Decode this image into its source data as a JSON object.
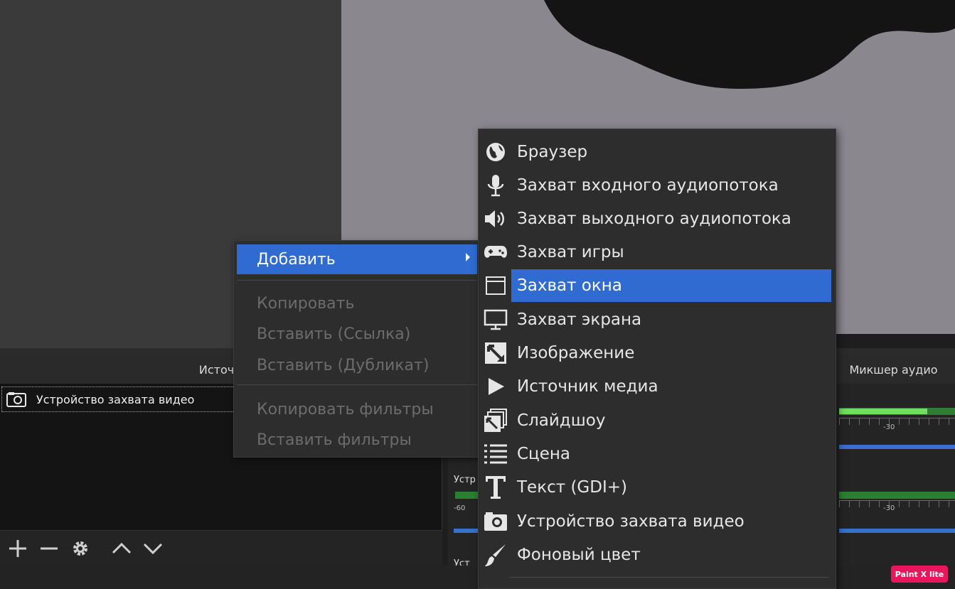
{
  "docks": {
    "sources_title": "Источни",
    "mixer_title": "Микшер аудио"
  },
  "sources": {
    "items": [
      {
        "label": "Устройство захвата видео",
        "icon": "camera-icon"
      }
    ],
    "toolbar": {
      "add": "plus-icon",
      "remove": "minus-icon",
      "settings": "gear-icon",
      "up": "chevron-up-icon",
      "down": "chevron-down-icon"
    }
  },
  "mixer": {
    "channels": [
      {
        "label": "",
        "tick_label": "-30"
      },
      {
        "label": "Устр",
        "tick_left": "-60",
        "tick_label": "-30"
      },
      {
        "label": "Уст"
      }
    ]
  },
  "context_menu": {
    "add": "Добавить",
    "copy": "Копировать",
    "paste_ref": "Вставить (Ссылка)",
    "paste_dup": "Вставить (Дубликат)",
    "copy_filters": "Копировать фильтры",
    "paste_filters": "Вставить фильтры"
  },
  "submenu": {
    "items": [
      {
        "label": "Браузер",
        "icon": "globe-icon"
      },
      {
        "label": "Захват входного аудиопотока",
        "icon": "microphone-icon"
      },
      {
        "label": "Захват выходного аудиопотока",
        "icon": "speaker-icon"
      },
      {
        "label": "Захват игры",
        "icon": "gamepad-icon"
      },
      {
        "label": "Захват окна",
        "icon": "window-icon",
        "active": true
      },
      {
        "label": "Захват экрана",
        "icon": "monitor-icon"
      },
      {
        "label": "Изображение",
        "icon": "image-icon"
      },
      {
        "label": "Источник медиа",
        "icon": "play-icon"
      },
      {
        "label": "Слайдшоу",
        "icon": "slideshow-icon"
      },
      {
        "label": "Сцена",
        "icon": "list-icon"
      },
      {
        "label": "Текст (GDI+)",
        "icon": "text-icon"
      },
      {
        "label": "Устройство захвата видео",
        "icon": "camera-icon"
      },
      {
        "label": "Фоновый цвет",
        "icon": "brush-icon"
      }
    ]
  },
  "badge": {
    "label": "Paint X lite"
  },
  "colors": {
    "highlight": "#2f6bd1",
    "menu_bg": "#2d2d2d",
    "meter": "#6ee05a",
    "volume": "#3a6fd0"
  }
}
